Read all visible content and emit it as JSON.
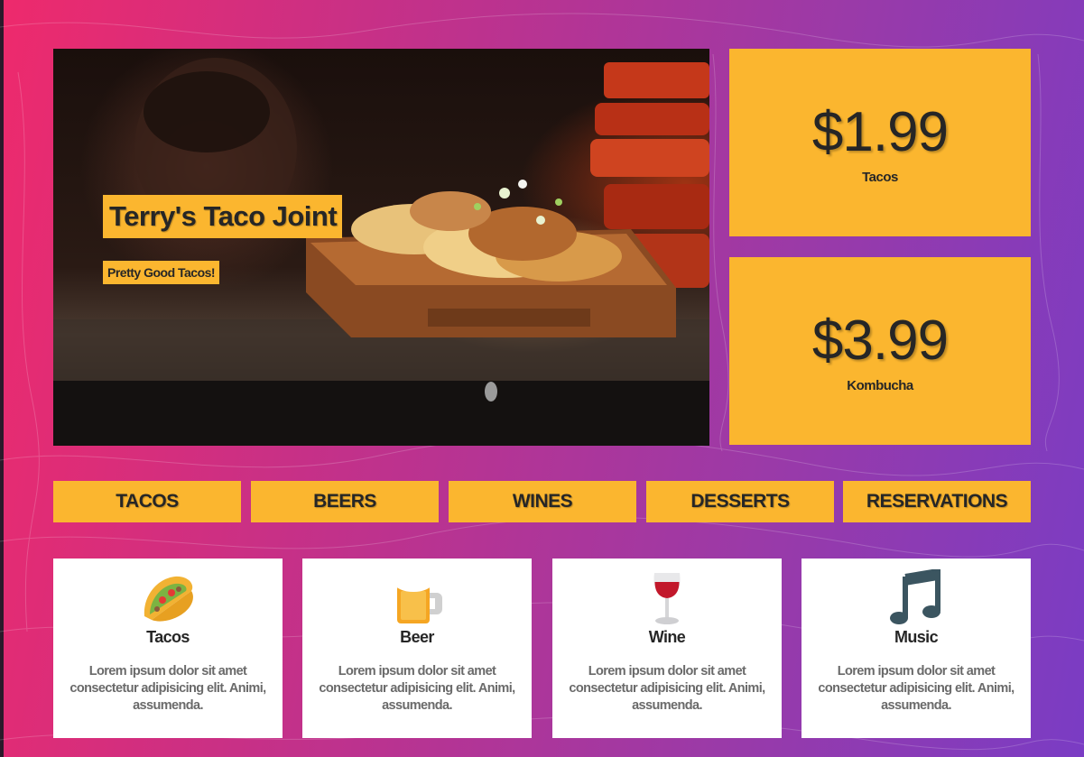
{
  "hero": {
    "title": "Terry's Taco Joint",
    "subtitle": "Pretty Good Tacos!"
  },
  "prices": [
    {
      "value": "$1.99",
      "label": "Tacos"
    },
    {
      "value": "$3.99",
      "label": "Kombucha"
    }
  ],
  "nav": {
    "items": [
      {
        "label": "TACOS"
      },
      {
        "label": "BEERS"
      },
      {
        "label": "WINES"
      },
      {
        "label": "DESSERTS"
      },
      {
        "label": "RESERVATIONS"
      }
    ]
  },
  "features": [
    {
      "icon": "taco-icon",
      "title": "Tacos",
      "text": "Lorem ipsum dolor sit amet consectetur adipisicing elit. Animi, assumenda."
    },
    {
      "icon": "beer-mug-icon",
      "title": "Beer",
      "text": "Lorem ipsum dolor sit amet consectetur adipisicing elit. Animi, assumenda."
    },
    {
      "icon": "wine-glass-icon",
      "title": "Wine",
      "text": "Lorem ipsum dolor sit amet consectetur adipisicing elit. Animi, assumenda."
    },
    {
      "icon": "music-note-icon",
      "title": "Music",
      "text": "Lorem ipsum dolor sit amet consectetur adipisicing elit. Animi, assumenda."
    }
  ],
  "colors": {
    "accent": "#fbb62f",
    "gradient_start": "#ee2a6c",
    "gradient_end": "#7a3cc4",
    "text_dark": "#262626"
  }
}
